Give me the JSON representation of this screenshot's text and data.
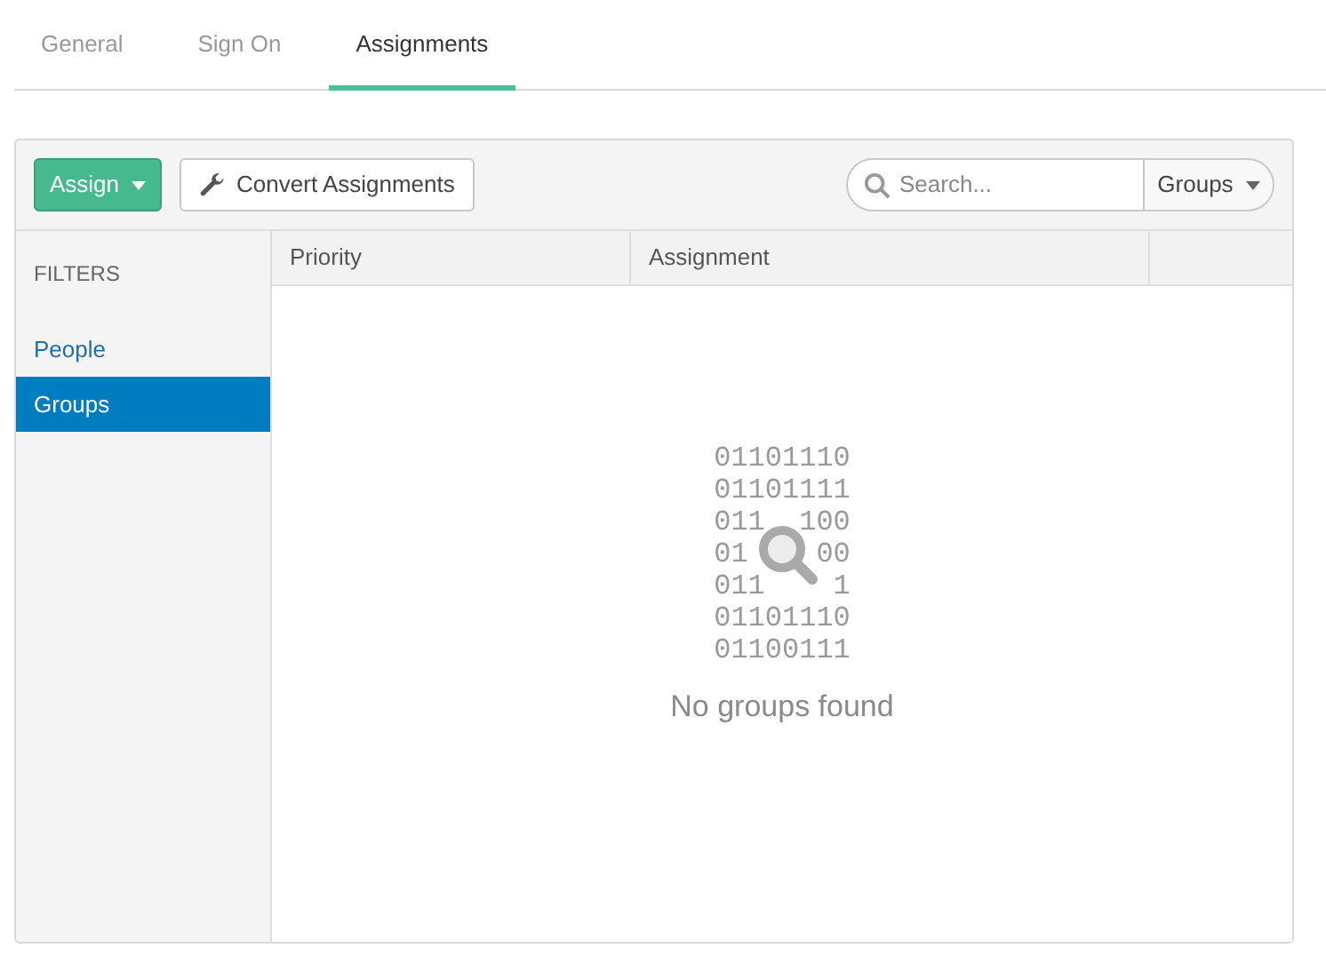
{
  "tabs": [
    {
      "label": "General",
      "selected": false
    },
    {
      "label": "Sign On",
      "selected": false
    },
    {
      "label": "Assignments",
      "selected": true
    }
  ],
  "toolbar": {
    "assign_button": "Assign",
    "convert_button": "Convert Assignments",
    "search": {
      "placeholder": "Search..."
    },
    "scope_dropdown": "Groups"
  },
  "filters": {
    "heading": "FILTERS",
    "items": [
      {
        "label": "People",
        "selected": false
      },
      {
        "label": "Groups",
        "selected": true
      }
    ]
  },
  "table": {
    "columns": [
      "Priority",
      "Assignment"
    ]
  },
  "empty_state": {
    "binary_lines": [
      "01101110",
      "01101111",
      "011  100",
      "01    00",
      "011    1",
      "01101110",
      "01100111"
    ],
    "message": "No groups found"
  }
}
